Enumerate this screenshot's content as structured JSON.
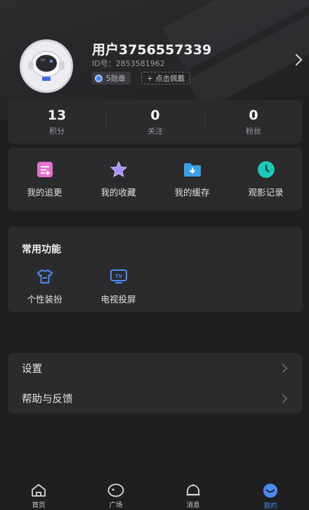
{
  "profile": {
    "username": "用户3756557339",
    "id_label": "ID号：",
    "id_value": "2853581962",
    "badge_label": "5勋章",
    "wear_label": "+ 点击佩戴"
  },
  "stats": [
    {
      "value": "13",
      "label": "积分"
    },
    {
      "value": "0",
      "label": "关注"
    },
    {
      "value": "0",
      "label": "粉丝"
    }
  ],
  "quick_actions": [
    {
      "label": "我的追更",
      "icon": "list-icon",
      "color": "#e46fd0"
    },
    {
      "label": "我的收藏",
      "icon": "star-icon",
      "color": "#a892f2"
    },
    {
      "label": "我的缓存",
      "icon": "download-folder-icon",
      "color": "#3ba0e6"
    },
    {
      "label": "观影记录",
      "icon": "clock-icon",
      "color": "#1ec9b8"
    }
  ],
  "common": {
    "title": "常用功能",
    "items": [
      {
        "label": "个性装扮",
        "icon": "shirt-icon"
      },
      {
        "label": "电视投屏",
        "icon": "tv-icon"
      }
    ]
  },
  "settings_rows": [
    {
      "label": "设置"
    },
    {
      "label": "帮助与反馈"
    }
  ],
  "tabs": [
    {
      "label": "首页",
      "icon": "home-icon"
    },
    {
      "label": "广场",
      "icon": "square-icon"
    },
    {
      "label": "消息",
      "icon": "bell-icon"
    },
    {
      "label": "我的",
      "icon": "profile-icon",
      "active": true
    }
  ],
  "colors": {
    "accent": "#4d8af0",
    "background": "#1f1f21",
    "card": "#2b2b2e"
  }
}
